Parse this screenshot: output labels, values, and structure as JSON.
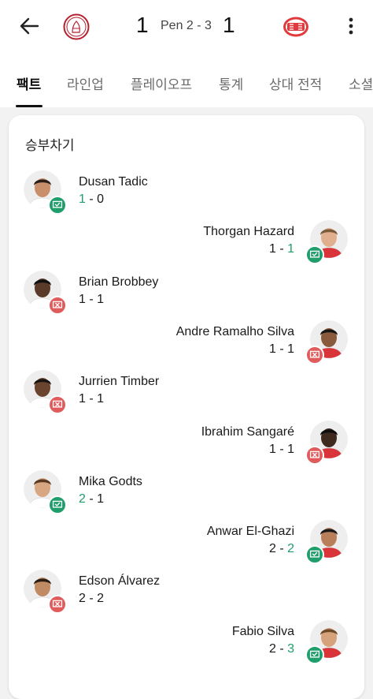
{
  "match": {
    "home_score": "1",
    "away_score": "1",
    "penalty_text": "Pen 2 - 3"
  },
  "tabs": [
    {
      "label": "팩트"
    },
    {
      "label": "라인업"
    },
    {
      "label": "플레이오프"
    },
    {
      "label": "통계"
    },
    {
      "label": "상대 전적"
    },
    {
      "label": "소셜"
    }
  ],
  "card_title": "승부차기",
  "colors": {
    "scored": "#1f9d6b",
    "missed": "#e05c5c"
  },
  "kicks": [
    {
      "name": "Dusan Tadic",
      "home": "1",
      "away": "0",
      "side": "home",
      "result": "scored"
    },
    {
      "name": "Thorgan Hazard",
      "home": "1",
      "away": "1",
      "side": "away",
      "result": "scored"
    },
    {
      "name": "Brian Brobbey",
      "home": "1",
      "away": "1",
      "side": "home",
      "result": "missed"
    },
    {
      "name": "Andre Ramalho Silva",
      "home": "1",
      "away": "1",
      "side": "away",
      "result": "missed"
    },
    {
      "name": "Jurrien Timber",
      "home": "1",
      "away": "1",
      "side": "home",
      "result": "missed"
    },
    {
      "name": "Ibrahim Sangaré",
      "home": "1",
      "away": "1",
      "side": "away",
      "result": "missed"
    },
    {
      "name": "Mika Godts",
      "home": "2",
      "away": "1",
      "side": "home",
      "result": "scored"
    },
    {
      "name": "Anwar El-Ghazi",
      "home": "2",
      "away": "2",
      "side": "away",
      "result": "scored"
    },
    {
      "name": "Edson Álvarez",
      "home": "2",
      "away": "2",
      "side": "home",
      "result": "missed"
    },
    {
      "name": "Fabio Silva",
      "home": "2",
      "away": "3",
      "side": "away",
      "result": "scored"
    }
  ]
}
